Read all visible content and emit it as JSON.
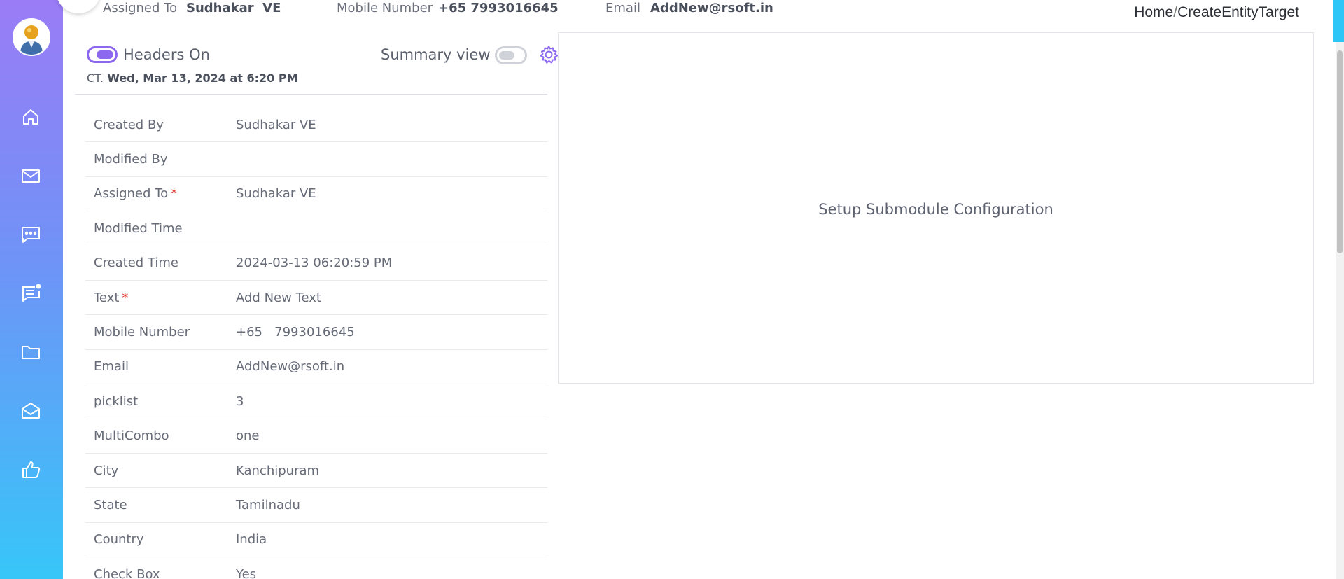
{
  "sidebar": {
    "items": [
      {
        "icon": "home-icon"
      },
      {
        "icon": "mail-icon"
      },
      {
        "icon": "chat-icon"
      },
      {
        "icon": "notes-icon"
      },
      {
        "icon": "folder-icon"
      },
      {
        "icon": "open-mail-icon"
      },
      {
        "icon": "thumbs-up-icon"
      }
    ]
  },
  "top_strip": {
    "assigned_label": "Assigned To",
    "assigned_value": "Sudhakar  VE",
    "mobile_label": "Mobile Number",
    "mobile_value": "+65 7993016645",
    "email_label": "Email",
    "email_value": "AddNew@rsoft.in"
  },
  "breadcrumb": {
    "home": "Home",
    "separator": "/",
    "current": "CreateEntityTarget"
  },
  "toggles": {
    "headers_label": "Headers On",
    "headers_on": true,
    "summary_label": "Summary view",
    "summary_on": false
  },
  "created": {
    "prefix": "CT.",
    "value": "Wed, Mar 13, 2024 at 6:20 PM"
  },
  "fields": [
    {
      "label": "Created By",
      "value": "Sudhakar VE",
      "required": ""
    },
    {
      "label": "Modified By",
      "value": "",
      "required": ""
    },
    {
      "label": "Assigned To",
      "value": "Sudhakar VE",
      "required": "*"
    },
    {
      "label": "Modified Time",
      "value": "",
      "required": ""
    },
    {
      "label": "Created Time",
      "value": "2024-03-13 06:20:59 PM",
      "required": ""
    },
    {
      "label": "Text",
      "value": "Add New Text",
      "required": "*"
    },
    {
      "label": "Mobile Number",
      "value": "+65   7993016645",
      "required": ""
    },
    {
      "label": "Email",
      "value": "AddNew@rsoft.in",
      "required": ""
    },
    {
      "label": "picklist",
      "value": "3",
      "required": ""
    },
    {
      "label": "MultiCombo",
      "value": "one",
      "required": ""
    },
    {
      "label": "City",
      "value": "Kanchipuram",
      "required": ""
    },
    {
      "label": "State",
      "value": "Tamilnadu",
      "required": ""
    },
    {
      "label": "Country",
      "value": "India",
      "required": ""
    },
    {
      "label": "Check Box",
      "value": "Yes",
      "required": ""
    }
  ],
  "right_panel": {
    "message": "Setup Submodule Configuration"
  },
  "colors": {
    "accent": "#8c68f0",
    "required": "#e0312f",
    "sidebar_top": "#9a7cf6",
    "sidebar_bottom": "#37c6f8"
  }
}
